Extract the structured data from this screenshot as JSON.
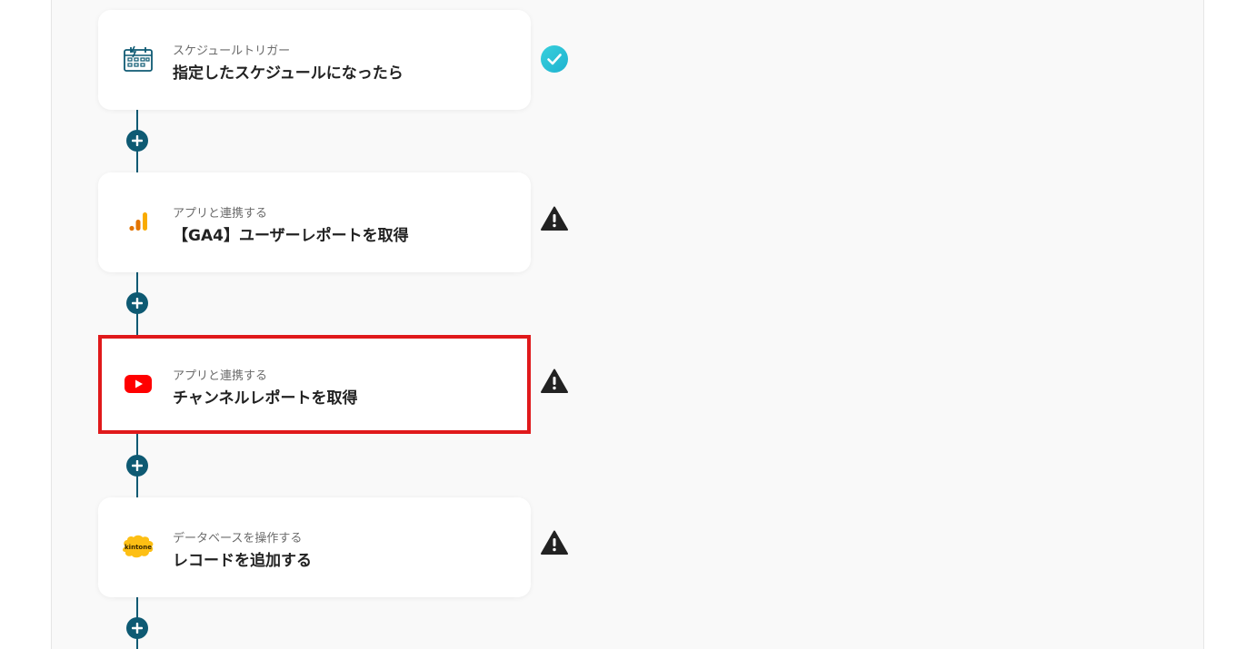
{
  "flow": {
    "steps": [
      {
        "subtitle": "スケジュールトリガー",
        "title": "指定したスケジュールになったら",
        "icon": "schedule-calendar-icon",
        "status": "completed"
      },
      {
        "subtitle": "アプリと連携する",
        "title": "【GA4】ユーザーレポートを取得",
        "icon": "google-analytics-icon",
        "status": "warning"
      },
      {
        "subtitle": "アプリと連携する",
        "title": "チャンネルレポートを取得",
        "icon": "youtube-icon",
        "status": "warning",
        "selected": true
      },
      {
        "subtitle": "データベースを操作する",
        "title": "レコードを追加する",
        "icon": "kintone-icon",
        "icon_text": "kintone",
        "status": "warning"
      }
    ]
  },
  "colors": {
    "connector": "#0e5a73",
    "check": "#2bc4d6",
    "warning": "#222222",
    "highlight": "#e0191b",
    "youtube": "#ff0000",
    "ga_orange": "#f9ab00",
    "kintone_yellow": "#fdbf14"
  }
}
